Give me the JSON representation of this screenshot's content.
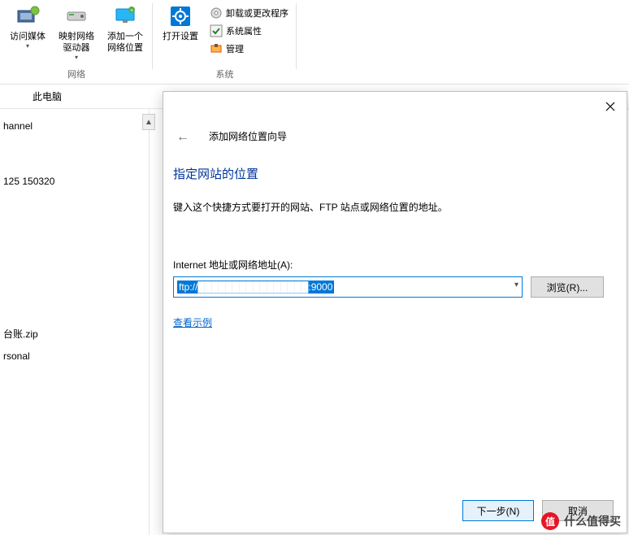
{
  "ribbon": {
    "network_group_label": "网络",
    "system_group_label": "系统",
    "access_media": "访问媒体",
    "map_drive": "映射网络驱动器",
    "add_location": "添加一个网络位置",
    "open_settings": "打开设置",
    "uninstall": "卸载或更改程序",
    "system_props": "系统属性",
    "manage": "管理"
  },
  "breadcrumb": {
    "this_pc": "此电脑"
  },
  "sidebar": {
    "items": [
      "hannel",
      "125 150320",
      "台账.zip",
      "rsonal"
    ]
  },
  "wizard": {
    "title": "添加网络位置向导",
    "heading": "指定网站的位置",
    "description": "键入这个快捷方式要打开的网站、FTP 站点或网络位置的地址。",
    "address_label": "Internet 地址或网络地址(A):",
    "address_prefix": "ftp://",
    "address_suffix": ":9000",
    "browse": "浏览(R)...",
    "example": "查看示例",
    "next": "下一步(N)",
    "cancel": "取消"
  },
  "watermark": {
    "text": "什么值得买"
  }
}
